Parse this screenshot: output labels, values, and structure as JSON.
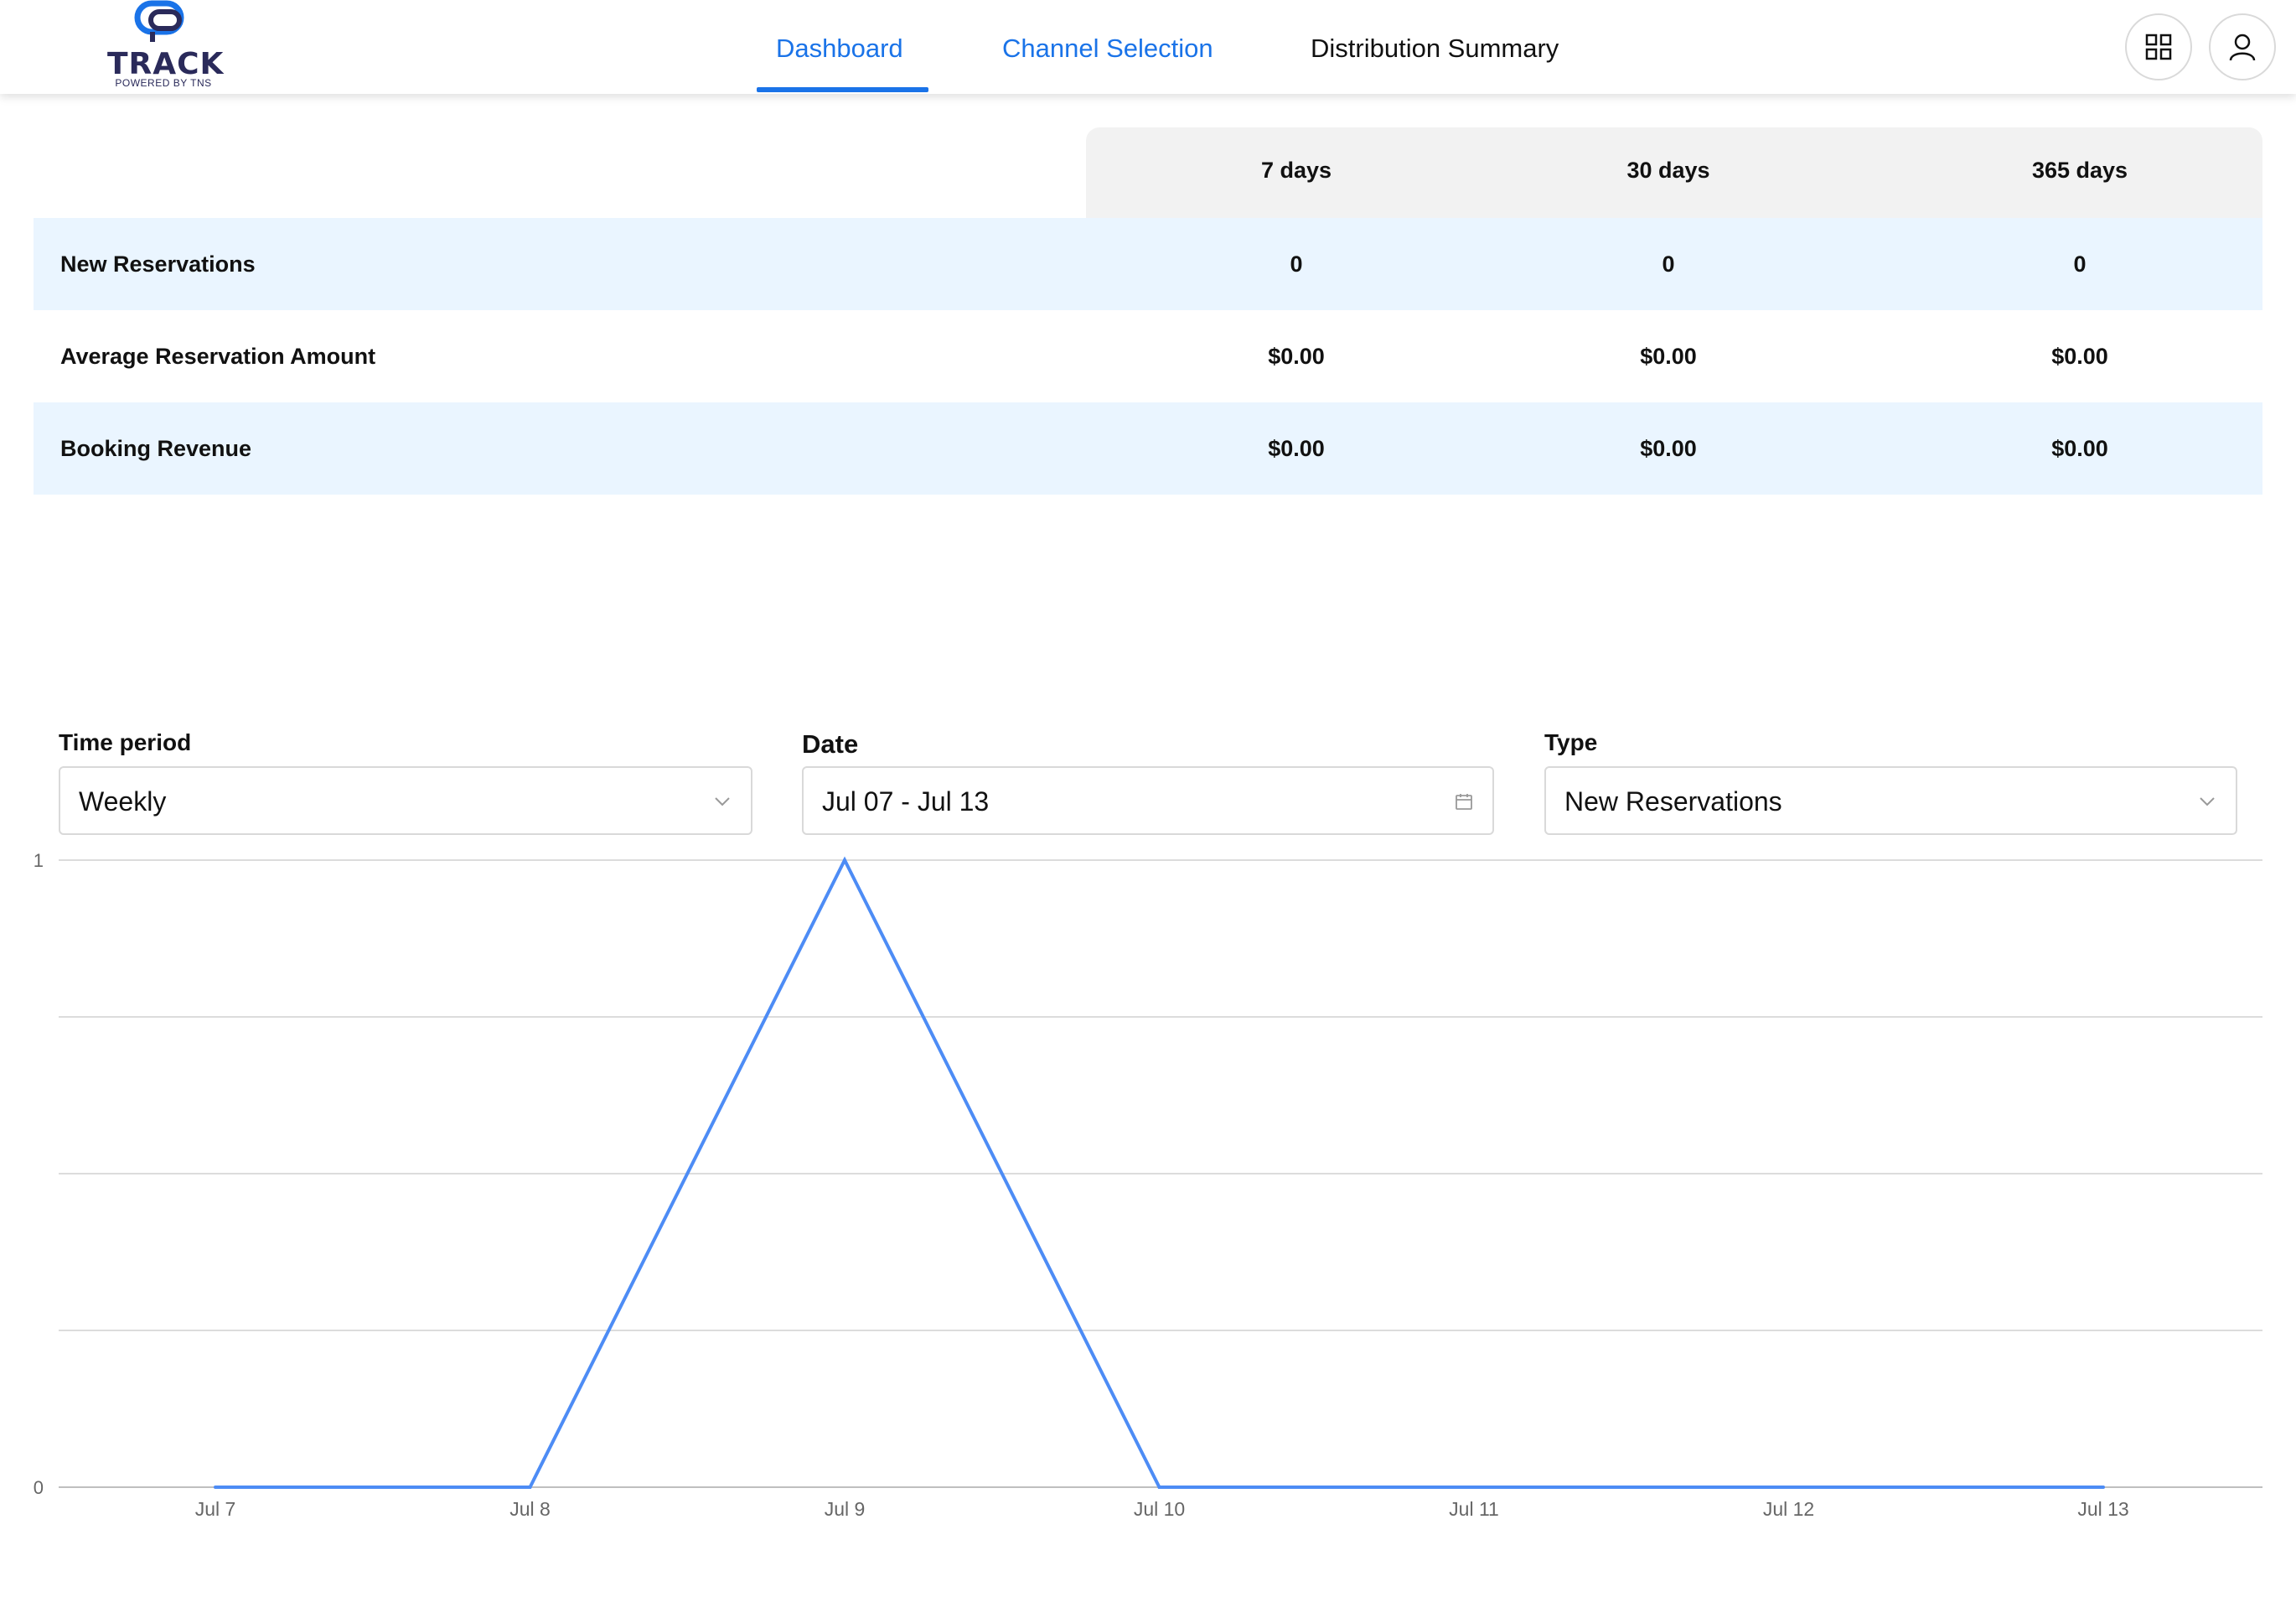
{
  "brand": {
    "name": "TRACK",
    "tagline": "POWERED BY TNS",
    "accent": "#1a73e8"
  },
  "nav": {
    "tabs": [
      {
        "label": "Dashboard",
        "active": true
      },
      {
        "label": "Channel Selection",
        "active": false
      },
      {
        "label": "Distribution Summary",
        "active": false
      }
    ]
  },
  "header_actions": {
    "apps_icon": "grid-icon",
    "user_icon": "user-icon"
  },
  "summary": {
    "columns": [
      "7 days",
      "30 days",
      "365 days"
    ],
    "rows": [
      {
        "label": "New Reservations",
        "values": [
          "0",
          "0",
          "0"
        ]
      },
      {
        "label": "Average Reservation Amount",
        "values": [
          "$0.00",
          "$0.00",
          "$0.00"
        ]
      },
      {
        "label": "Booking Revenue",
        "values": [
          "$0.00",
          "$0.00",
          "$0.00"
        ]
      }
    ]
  },
  "filters": {
    "time_period": {
      "label": "Time period",
      "value": "Weekly",
      "icon": "chevron-down-icon"
    },
    "date": {
      "label": "Date",
      "value": "Jul 07 - Jul 13",
      "icon": "calendar-icon"
    },
    "type": {
      "label": "Type",
      "value": "New Reservations",
      "icon": "chevron-down-icon"
    }
  },
  "chart_data": {
    "type": "line",
    "categories": [
      "Jul 7",
      "Jul 8",
      "Jul 9",
      "Jul 10",
      "Jul 11",
      "Jul 12",
      "Jul 13"
    ],
    "series": [
      {
        "values": [
          0,
          0,
          1,
          0,
          0,
          0,
          0
        ],
        "color": "#4d8cf5"
      }
    ],
    "ylim": [
      0,
      1
    ],
    "yticks": [
      "0",
      "1"
    ],
    "grid": true
  }
}
